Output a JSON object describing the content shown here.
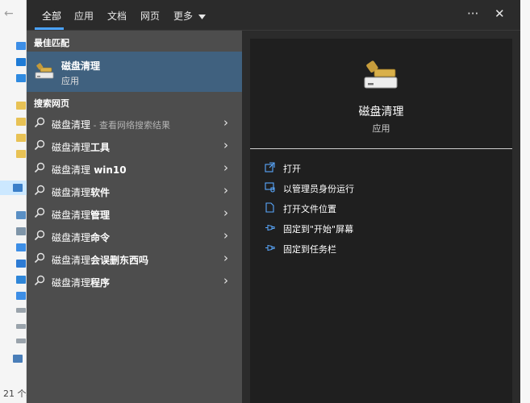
{
  "explorer": {
    "back_glyph": "←",
    "status_text": "21 个项"
  },
  "tabs": [
    {
      "label": "全部",
      "active": true
    },
    {
      "label": "应用",
      "active": false
    },
    {
      "label": "文档",
      "active": false
    },
    {
      "label": "网页",
      "active": false
    },
    {
      "label": "更多",
      "active": false
    }
  ],
  "top_actions": {
    "more_glyph": "···",
    "close_glyph": "✕"
  },
  "best_match": {
    "section_title": "最佳匹配",
    "name": "磁盘清理",
    "type": "应用",
    "icon": "disk-cleanup-icon"
  },
  "web_search": {
    "section_title": "搜索网页",
    "items": [
      {
        "query": "磁盘清理",
        "suffix": "",
        "hint": " - 查看网络搜索结果"
      },
      {
        "query": "磁盘清理",
        "suffix": "工具",
        "hint": ""
      },
      {
        "query": "磁盘清理",
        "suffix": " win10",
        "hint": ""
      },
      {
        "query": "磁盘清理",
        "suffix": "软件",
        "hint": ""
      },
      {
        "query": "磁盘清理",
        "suffix": "管理",
        "hint": ""
      },
      {
        "query": "磁盘清理",
        "suffix": "命令",
        "hint": ""
      },
      {
        "query": "磁盘清理",
        "suffix": "会误删东西吗",
        "hint": ""
      },
      {
        "query": "磁盘清理",
        "suffix": "程序",
        "hint": ""
      }
    ]
  },
  "preview": {
    "name": "磁盘清理",
    "type": "应用",
    "actions": [
      {
        "label": "打开",
        "icon": "open-icon"
      },
      {
        "label": "以管理员身份运行",
        "icon": "admin-shield-icon"
      },
      {
        "label": "打开文件位置",
        "icon": "file-location-icon"
      },
      {
        "label": "固定到\"开始\"屏幕",
        "icon": "pin-icon"
      },
      {
        "label": "固定到任务栏",
        "icon": "pin-icon"
      }
    ]
  },
  "colors": {
    "accent": "#4aa3ff",
    "selected_row": "#40617f",
    "left_bg": "#4d4d4d",
    "preview_bg": "#1f1f1f"
  }
}
